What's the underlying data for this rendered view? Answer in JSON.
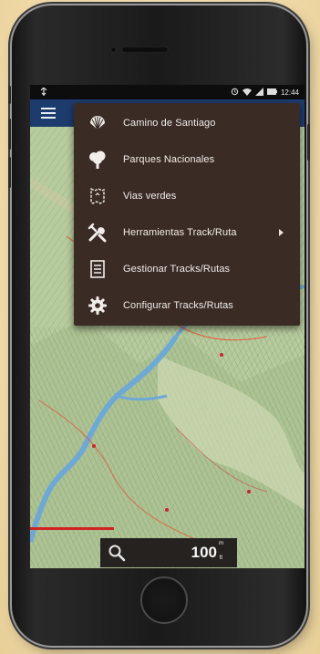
{
  "status_bar": {
    "time": "12:44",
    "left_icon": "usb-icon",
    "right_icons": [
      "alarm-icon",
      "wifi-icon",
      "signal-icon",
      "battery-icon"
    ]
  },
  "toolbar": {
    "menu_icon": "hamburger-menu-icon",
    "color": "#1e3b6e"
  },
  "menu": {
    "items": [
      {
        "label": "Camino de Santiago",
        "icon": "scallop-shell-icon"
      },
      {
        "label": "Parques Nacionales",
        "icon": "tree-icon"
      },
      {
        "label": "Vias verdes",
        "icon": "green-route-icon"
      },
      {
        "label": "Herramientas Track/Ruta",
        "icon": "tools-icon",
        "submenu": true
      },
      {
        "label": "Gestionar Tracks/Rutas",
        "icon": "list-document-icon"
      },
      {
        "label": "Configurar Tracks/Rutas",
        "icon": "gear-icon"
      }
    ],
    "background": "#3a2b25"
  },
  "map": {
    "scale_bar_color": "#d22323"
  },
  "bottom_panel": {
    "search_icon": "search-icon",
    "zoom_value": "100",
    "zoom_unit_top": "m",
    "zoom_unit_bottom": "ft"
  }
}
